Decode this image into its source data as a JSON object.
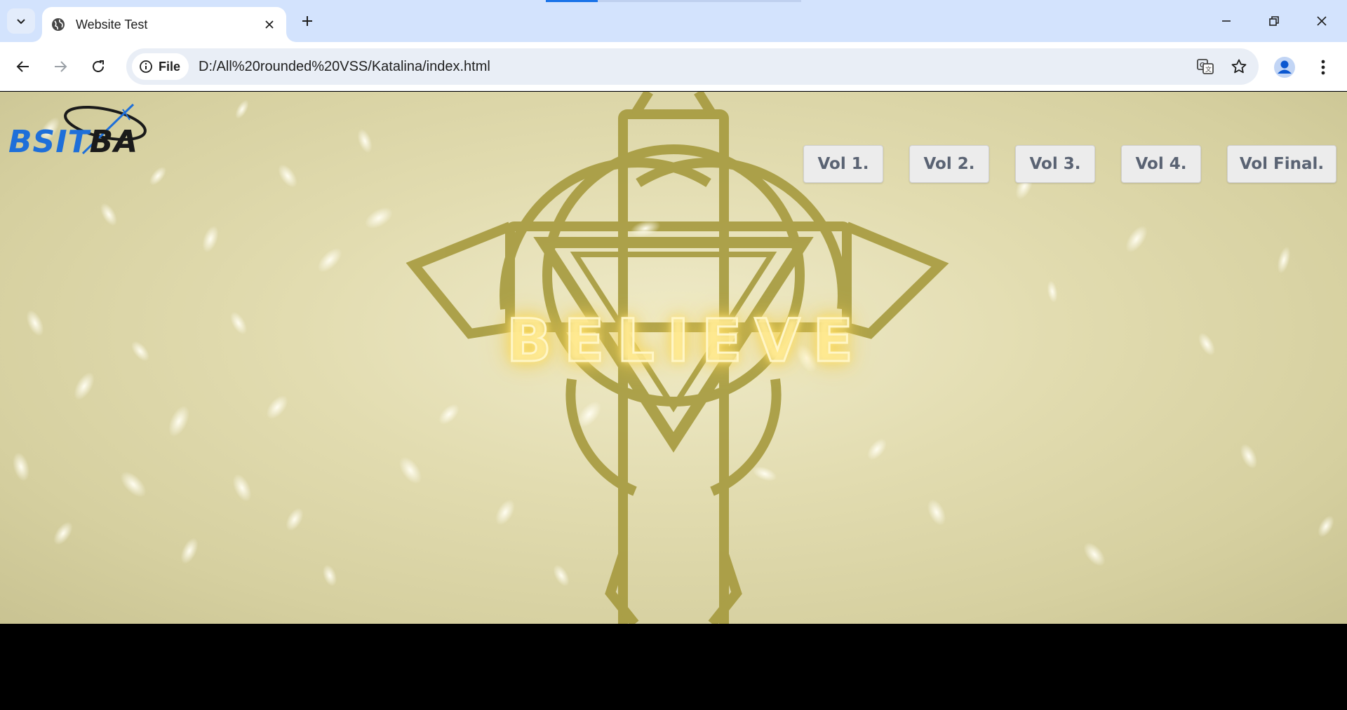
{
  "browser": {
    "tab_title": "Website Test",
    "chip_label": "File",
    "url": "D:/All%20rounded%20VSS/Katalina/index.html",
    "icons": {
      "tab_search": "chevron-down-icon",
      "favicon": "globe-icon",
      "tab_close": "close-icon",
      "new_tab": "plus-icon",
      "minimize": "minimize-icon",
      "restore": "restore-icon",
      "close_window": "close-icon",
      "back": "back-arrow-icon",
      "forward": "forward-arrow-icon",
      "reload": "reload-icon",
      "site_info": "info-icon",
      "translate": "translate-icon",
      "bookmark": "star-icon",
      "profile": "profile-icon",
      "menu": "kebab-menu-icon"
    }
  },
  "page": {
    "logo_text_blue": "BSIT",
    "logo_text_dark": "BA",
    "hero_text": "BELIEVE",
    "nav": [
      "Vol 1.",
      "Vol 2.",
      "Vol 3.",
      "Vol 4.",
      "Vol Final."
    ]
  },
  "colors": {
    "accent": "#1a73e8",
    "tabstrip": "#d3e3fd",
    "omnibox": "#e9eef6",
    "hero_background": "#e2dcb0",
    "emblem_gold": "#a69a3e",
    "button_bg": "#ececec",
    "button_text": "#5a6373",
    "logo_blue": "#1e6fd9"
  }
}
